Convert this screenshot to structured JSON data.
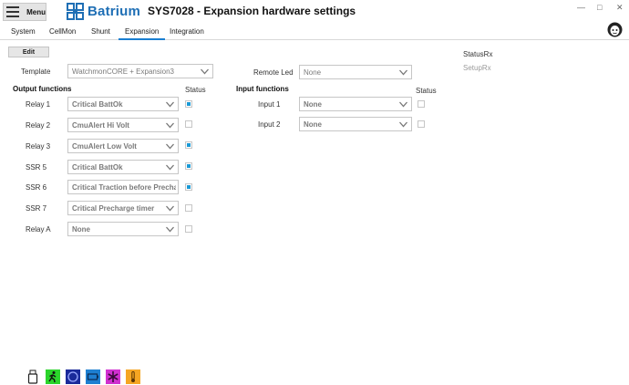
{
  "header": {
    "menu_label": "Menu",
    "logo_text": "Batrium",
    "title": "SYS7028 - Expansion hardware settings",
    "window_controls": {
      "minimize": "—",
      "maximize": "□",
      "close": "✕"
    }
  },
  "tabs": [
    {
      "label": "System"
    },
    {
      "label": "CellMon"
    },
    {
      "label": "Shunt"
    },
    {
      "label": "Expansion",
      "active": true
    },
    {
      "label": "Integration"
    }
  ],
  "toolbar": {
    "edit_label": "Edit"
  },
  "status": {
    "status_rx": "StatusRx",
    "setup_rx": "SetupRx"
  },
  "template": {
    "label": "Template",
    "value": "WatchmonCORE + Expansion3"
  },
  "remote_led": {
    "label": "Remote Led",
    "value": "None"
  },
  "output_section": {
    "title": "Output functions",
    "status_header": "Status"
  },
  "outputs": [
    {
      "label": "Relay 1",
      "value": "Critical BattOk",
      "checked": true
    },
    {
      "label": "Relay 2",
      "value": "CmuAlert Hi Volt",
      "checked": false
    },
    {
      "label": "Relay 3",
      "value": "CmuAlert Low Volt",
      "checked": true
    },
    {
      "label": "SSR 5",
      "value": "Critical BattOk",
      "checked": true
    },
    {
      "label": "SSR 6",
      "value": "Critical Traction before Precharge",
      "checked": true
    },
    {
      "label": "SSR 7",
      "value": "Critical Precharge timer",
      "checked": false
    },
    {
      "label": "Relay A",
      "value": "None",
      "checked": false
    }
  ],
  "input_section": {
    "title": "Input functions",
    "status_header": "Status"
  },
  "inputs": [
    {
      "label": "Input 1",
      "value": "None",
      "checked": false
    },
    {
      "label": "Input 2",
      "value": "None",
      "checked": false
    }
  ],
  "bottom_icons": [
    {
      "name": "usb-icon",
      "color": "#ffffff"
    },
    {
      "name": "running-man-icon",
      "color": "#2bd42b"
    },
    {
      "name": "circle-icon",
      "color": "#1a2a9a"
    },
    {
      "name": "battery-icon",
      "color": "#1e7fd1"
    },
    {
      "name": "fan-icon",
      "color": "#d030d0"
    },
    {
      "name": "thermometer-icon",
      "color": "#f5a623"
    }
  ],
  "colors": {
    "accent": "#1a7fd1",
    "checkbox_fill": "#1a9ad6",
    "logo": "#1f6fb5"
  }
}
